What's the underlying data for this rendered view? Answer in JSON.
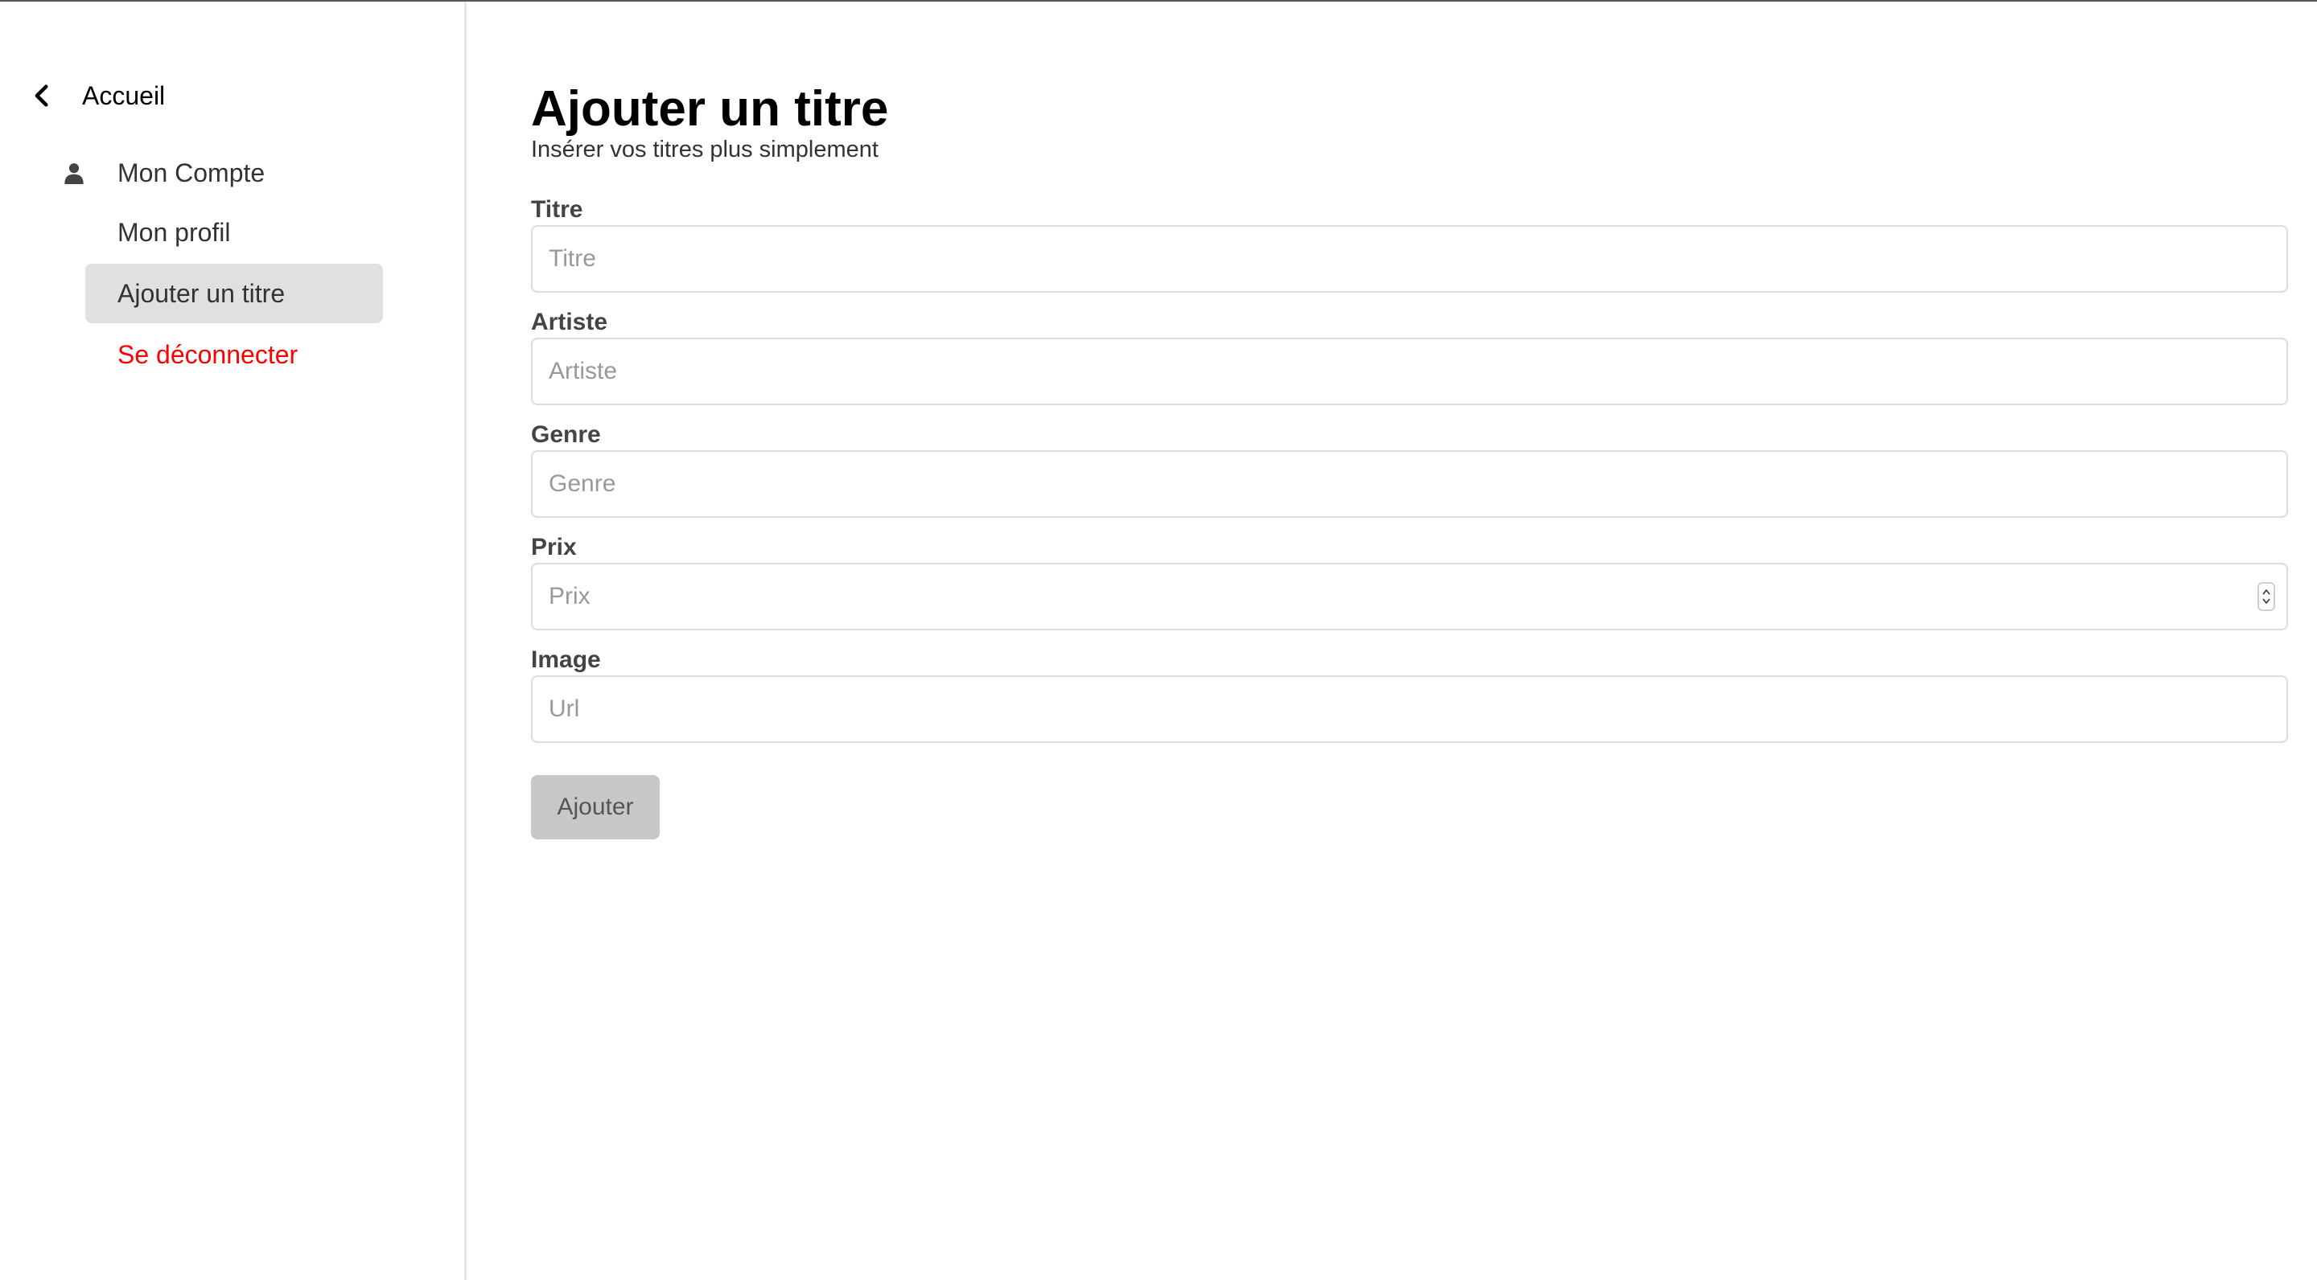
{
  "sidebar": {
    "back_label": "Accueil",
    "account_label": "Mon Compte",
    "items": [
      {
        "label": "Mon profil"
      },
      {
        "label": "Ajouter un titre"
      },
      {
        "label": "Se déconnecter"
      }
    ]
  },
  "main": {
    "title": "Ajouter un titre",
    "subtitle": "Insérer vos titres plus simplement",
    "fields": [
      {
        "label": "Titre",
        "placeholder": "Titre",
        "value": ""
      },
      {
        "label": "Artiste",
        "placeholder": "Artiste",
        "value": ""
      },
      {
        "label": "Genre",
        "placeholder": "Genre",
        "value": ""
      },
      {
        "label": "Prix",
        "placeholder": "Prix",
        "value": ""
      },
      {
        "label": "Image",
        "placeholder": "Url",
        "value": ""
      }
    ],
    "submit_label": "Ajouter"
  },
  "colors": {
    "logout": "#ff0000",
    "active_item_bg": "#e0e0e0",
    "submit_bg": "#c8c8c8"
  },
  "icons": {
    "back": "chevron-left-icon",
    "account": "user-icon"
  }
}
